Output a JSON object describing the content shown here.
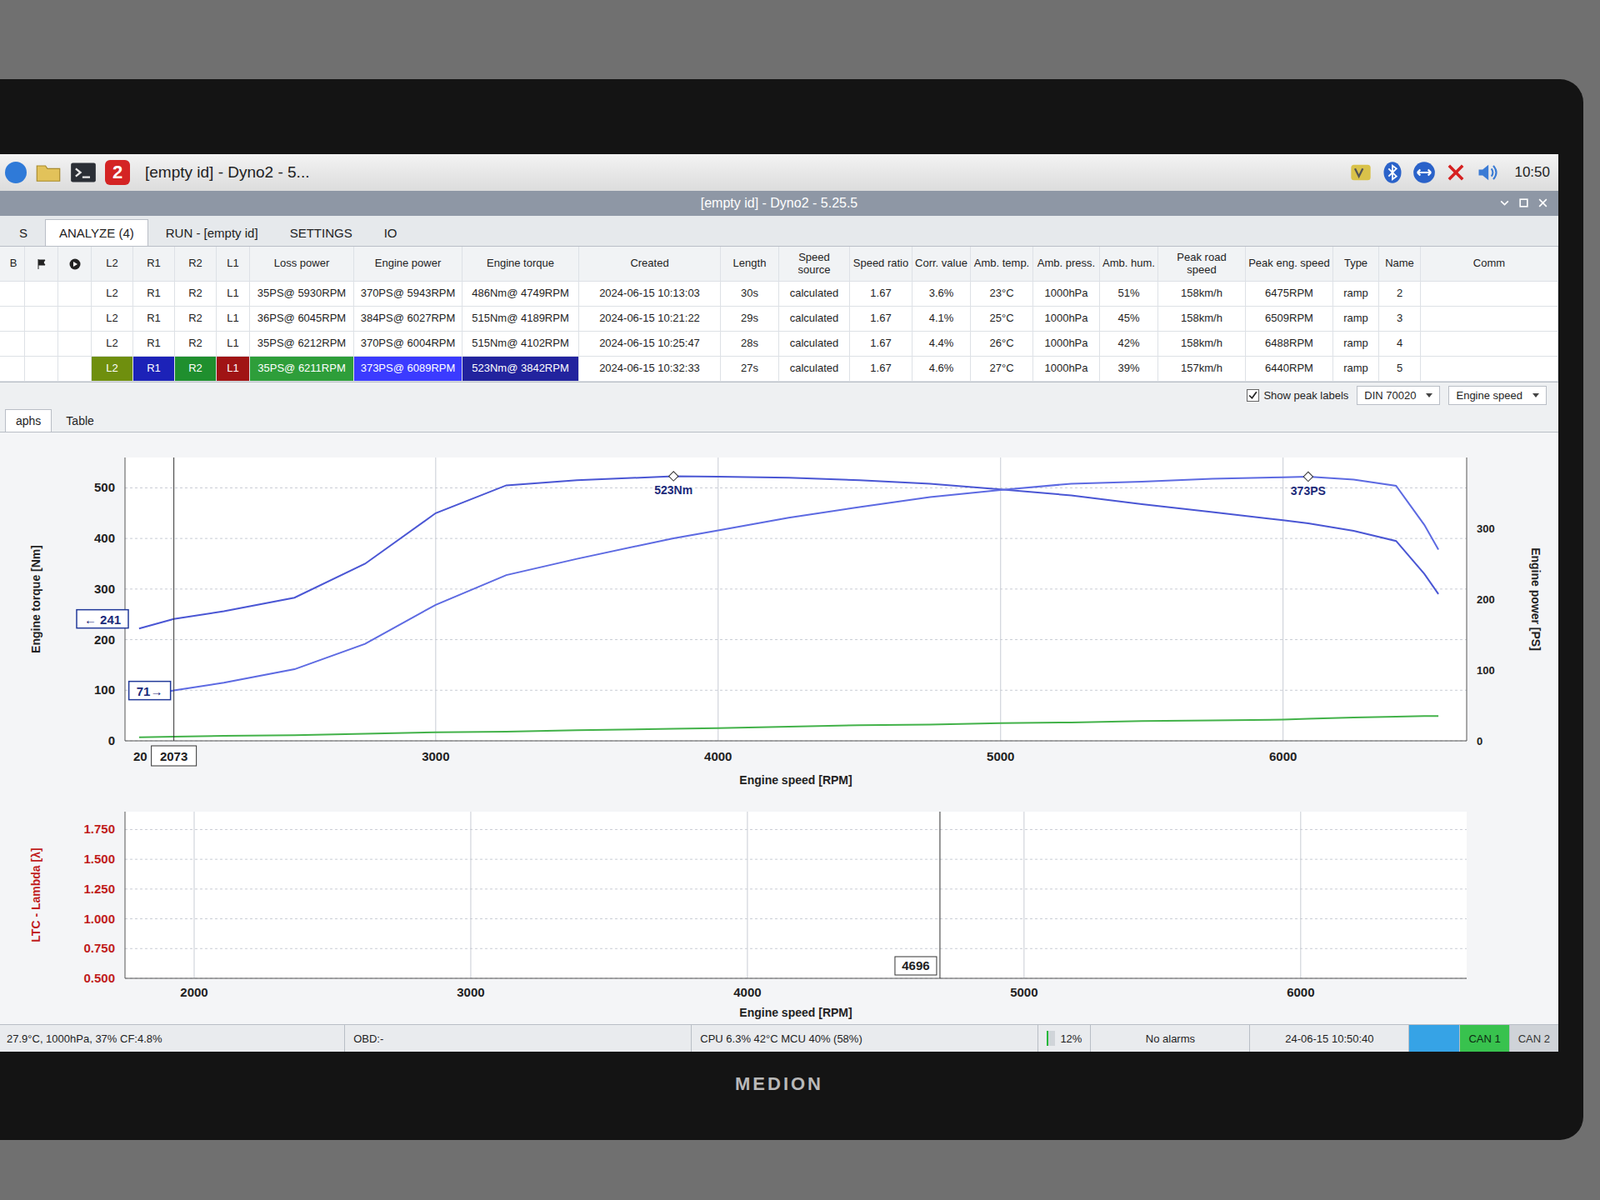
{
  "bezel": {
    "brand": "MEDION"
  },
  "taskbar": {
    "app_badge": "2",
    "task": "[empty id] - Dyno2 - 5...",
    "clock": "10:50"
  },
  "window": {
    "title": "[empty id] - Dyno2 - 5.25.5"
  },
  "tabs": [
    {
      "label": "S",
      "selected": false
    },
    {
      "label": "ANALYZE (4)",
      "selected": true
    },
    {
      "label": "RUN - [empty id]",
      "selected": false
    },
    {
      "label": "SETTINGS",
      "selected": false
    },
    {
      "label": "IO",
      "selected": false
    }
  ],
  "table": {
    "lead_column": "B",
    "columns": [
      {
        "label": "L2",
        "color": "#6f8f0e"
      },
      {
        "label": "R1",
        "color": "#1c22b8"
      },
      {
        "label": "R2",
        "color": "#1f8f2e"
      },
      {
        "label": "L1",
        "color": "#a01414"
      },
      {
        "label": "Loss power",
        "color": "#2e9e3a"
      },
      {
        "label": "Engine power",
        "color": "#3b3bff"
      },
      {
        "label": "Engine torque",
        "color": "#22239e"
      },
      {
        "label": "Created"
      },
      {
        "label": "Length"
      },
      {
        "label": "Speed source"
      },
      {
        "label": "Speed ratio"
      },
      {
        "label": "Corr. value"
      },
      {
        "label": "Amb. temp."
      },
      {
        "label": "Amb. press."
      },
      {
        "label": "Amb. hum."
      },
      {
        "label": "Peak road speed"
      },
      {
        "label": "Peak eng. speed"
      },
      {
        "label": "Type"
      },
      {
        "label": "Name"
      },
      {
        "label": "Comm"
      }
    ],
    "rows": [
      {
        "selected": false,
        "cells": [
          "L2",
          "R1",
          "R2",
          "L1",
          "35PS@ 5930RPM",
          "370PS@ 5943RPM",
          "486Nm@ 4749RPM",
          "2024-06-15 10:13:03",
          "30s",
          "calculated",
          "1.67",
          "3.6%",
          "23°C",
          "1000hPa",
          "51%",
          "158km/h",
          "6475RPM",
          "ramp",
          "2"
        ]
      },
      {
        "selected": false,
        "cells": [
          "L2",
          "R1",
          "R2",
          "L1",
          "36PS@ 6045RPM",
          "384PS@ 6027RPM",
          "515Nm@ 4189RPM",
          "2024-06-15 10:21:22",
          "29s",
          "calculated",
          "1.67",
          "4.1%",
          "25°C",
          "1000hPa",
          "45%",
          "158km/h",
          "6509RPM",
          "ramp",
          "3"
        ]
      },
      {
        "selected": false,
        "cells": [
          "L2",
          "R1",
          "R2",
          "L1",
          "35PS@ 6212RPM",
          "370PS@ 6004RPM",
          "515Nm@ 4102RPM",
          "2024-06-15 10:25:47",
          "28s",
          "calculated",
          "1.67",
          "4.4%",
          "26°C",
          "1000hPa",
          "42%",
          "158km/h",
          "6488RPM",
          "ramp",
          "4"
        ]
      },
      {
        "selected": true,
        "cells": [
          "L2",
          "R1",
          "R2",
          "L1",
          "35PS@ 6211RPM",
          "373PS@ 6089RPM",
          "523Nm@ 3842RPM",
          "2024-06-15 10:32:33",
          "27s",
          "calculated",
          "1.67",
          "4.6%",
          "27°C",
          "1000hPa",
          "39%",
          "157km/h",
          "6440RPM",
          "ramp",
          "5"
        ]
      }
    ]
  },
  "chart_options": {
    "show_peak_labels": {
      "label": "Show peak labels",
      "checked": true
    },
    "standard": "DIN 70020",
    "x_axis": "Engine speed"
  },
  "view_tabs": [
    {
      "label": "aphs",
      "selected": true
    },
    {
      "label": "Table",
      "selected": false
    }
  ],
  "power_chart": {
    "y_left": {
      "label": "Engine torque [Nm]",
      "ticks": [
        "0",
        "100",
        "200",
        "300",
        "400",
        "500"
      ],
      "max": 560
    },
    "y_right": {
      "label": "Engine power [PS]",
      "ticks": [
        "0",
        "100",
        "200",
        "300"
      ],
      "max": 400
    },
    "x": {
      "label": "Engine speed [RPM]",
      "ticks": [
        "3000",
        "4000",
        "5000",
        "6000"
      ],
      "min": 1900,
      "max": 6650
    },
    "rpm": [
      1950,
      2073,
      2250,
      2500,
      2750,
      3000,
      3250,
      3500,
      3842,
      4000,
      4250,
      4500,
      4750,
      5000,
      5250,
      5500,
      5750,
      6000,
      6089,
      6250,
      6400,
      6500,
      6550
    ],
    "series": [
      {
        "axis": "left",
        "color": "#4a56d4",
        "peak_label": "523Nm",
        "values": [
          222,
          241,
          256,
          283,
          350,
          450,
          505,
          515,
          523,
          522,
          520,
          515,
          508,
          497,
          485,
          468,
          452,
          436,
          430,
          415,
          395,
          330,
          290
        ]
      },
      {
        "axis": "right",
        "color": "#5d6ae2",
        "peak_label": "373PS",
        "values": [
          62,
          71,
          82,
          101,
          137,
          192,
          234,
          257,
          286,
          297,
          315,
          330,
          344,
          354,
          363,
          366,
          370,
          372,
          373,
          369,
          360,
          305,
          270
        ]
      },
      {
        "axis": "right",
        "color": "#43b24a",
        "values": [
          5,
          6,
          7,
          8,
          10,
          12,
          13,
          15,
          17,
          18,
          20,
          22,
          23,
          25,
          26,
          28,
          29,
          30,
          31,
          33,
          34,
          35,
          35
        ]
      }
    ],
    "cursor": {
      "rpm_label": "2073",
      "cut_tick": "20",
      "left_reading": "← 241",
      "right_reading": "71→"
    }
  },
  "lambda_chart": {
    "y_label": "LTC - Lambda [λ]",
    "y_ticks": [
      "0.500",
      "0.750",
      "1.000",
      "1.250",
      "1.500",
      "1.750"
    ],
    "y_min": 0.5,
    "y_max": 1.9,
    "x_label": "Engine speed [RPM]",
    "x_ticks": [
      "2000",
      "3000",
      "4000",
      "5000",
      "6000"
    ],
    "x_min": 1750,
    "x_max": 6600,
    "cursor": "4696"
  },
  "status_bar": {
    "environment": "27.9°C, 1000hPa, 37% CF:4.8%",
    "obd": "OBD:-",
    "cpu": "CPU 6.3% 42°C MCU 40% (58%)",
    "load": {
      "reading": "12%",
      "level": 0.12
    },
    "alarms": "No alarms",
    "timestamp": "24-06-15 10:50:40",
    "can": [
      {
        "label": "CAN 1",
        "on": true
      },
      {
        "label": "CAN 2",
        "on": false
      }
    ]
  }
}
